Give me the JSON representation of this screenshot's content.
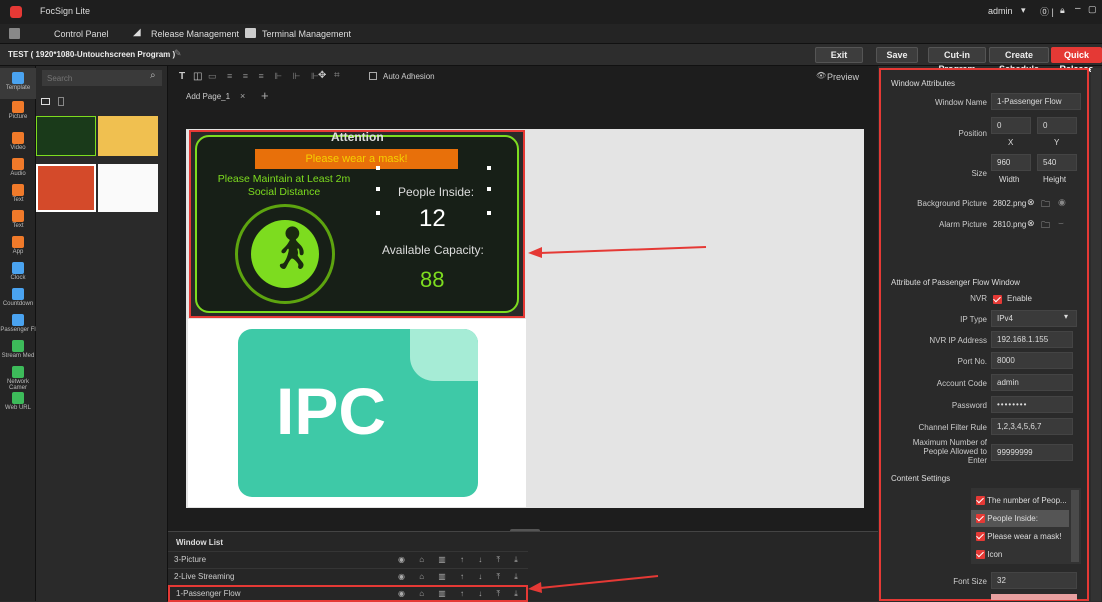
{
  "app": {
    "title": "FocSign Lite",
    "user": "admin"
  },
  "tabs": [
    "Control Panel",
    "Release Management",
    "Terminal Management"
  ],
  "program": {
    "title": "TEST ( 1920*1080-Untouchscreen Program )"
  },
  "toolbar": {
    "exit": "Exit",
    "save": "Save",
    "cutin": "Cut-in Program",
    "schedule": "Create Schedule",
    "quick": "Quick Release"
  },
  "leftnav": [
    "Template",
    "Picture",
    "Video",
    "Audio",
    "Text",
    "Text",
    "App",
    "Clock",
    "Countdown",
    "Passenger Fl",
    "Stream Med",
    "Network Camer",
    "Web URL"
  ],
  "library": {
    "search_placeholder": "Search"
  },
  "editor": {
    "auto_adhesion": "Auto Adhesion",
    "preview": "Preview",
    "page_tab": "Add Page_1"
  },
  "canvas": {
    "attention": "Attention",
    "mask": "Please wear a mask!",
    "maintain": "Please Maintain at Least 2m Social Distance",
    "people_inside": "People Inside:",
    "people_count": "12",
    "capacity_label": "Available Capacity:",
    "capacity_value": "88",
    "ipc": "IPC"
  },
  "window_list": {
    "title": "Window List",
    "items": [
      "3-Picture",
      "2-Live Streaming",
      "1-Passenger Flow"
    ]
  },
  "props": {
    "section1": "Window Attributes",
    "window_name_label": "Window Name",
    "window_name": "1-Passenger Flow",
    "position_label": "Position",
    "pos_x": "0",
    "pos_y": "0",
    "x_label": "X",
    "y_label": "Y",
    "size_label": "Size",
    "width": "960",
    "height": "540",
    "width_label": "Width",
    "height_label": "Height",
    "bg_label": "Background Picture",
    "bg_value": "2802.png",
    "alarm_label": "Alarm Picture",
    "alarm_value": "2810.png",
    "section2": "Attribute of Passenger Flow Window",
    "nvr_label": "NVR",
    "nvr_enable": "Enable",
    "iptype_label": "IP Type",
    "iptype": "IPv4",
    "nvrip_label": "NVR IP Address",
    "nvrip": "192.168.1.155",
    "port_label": "Port No.",
    "port": "8000",
    "account_label": "Account Code",
    "account": "admin",
    "password_label": "Password",
    "password": "••••••••",
    "channel_label": "Channel Filter Rule",
    "channel": "1,2,3,4,5,6,7",
    "maxpeople_label": "Maximum Number of People Allowed to Enter",
    "maxpeople": "99999999",
    "content_label": "Content Settings",
    "content_items": [
      "The number of Peop...",
      "People Inside:",
      "Please wear a mask!",
      "Icon"
    ],
    "fontsize_label": "Font Size",
    "fontsize": "32"
  },
  "colors": {
    "accent_red": "#e53935",
    "neon_green": "#7ddc1f",
    "mask_orange": "#e8700a",
    "ipc_teal": "#3ec9a7"
  }
}
